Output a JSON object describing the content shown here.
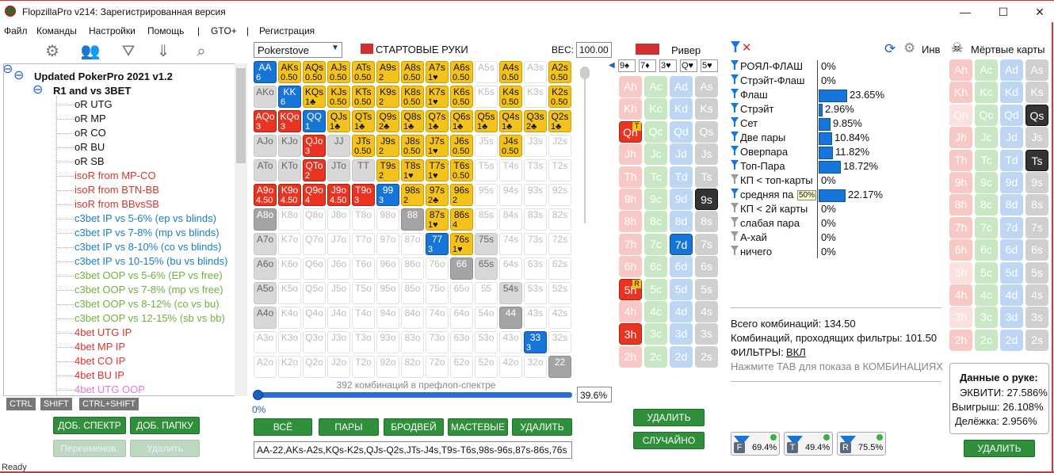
{
  "window": {
    "title": "FlopzillaPro v214: Зарегистрированная версия",
    "min": "—",
    "max": "☐",
    "close": "✕"
  },
  "menu": [
    "Файл",
    "Команды",
    "Настройки",
    "Помощь",
    "|",
    "GTO+",
    "|",
    "Регистрация"
  ],
  "toolbar_icons": [
    "gear-icon",
    "users-icon",
    "filter-icon",
    "download-icon",
    "search-icon"
  ],
  "tree": {
    "root_toggle": "⊖",
    "root": "Updated PokerPro 2021 v1.2",
    "folder_toggle": "⊖",
    "folder": "R1 and vs 3BET",
    "items": [
      {
        "label": "oR UTG",
        "color": "#111111"
      },
      {
        "label": "oR MP",
        "color": "#111111"
      },
      {
        "label": "oR CO",
        "color": "#111111"
      },
      {
        "label": "oR BU",
        "color": "#111111"
      },
      {
        "label": "oR SB",
        "color": "#111111"
      },
      {
        "label": "isoR from MP-CO",
        "color": "#d9342b"
      },
      {
        "label": "isoR from BTN-BB",
        "color": "#d9342b"
      },
      {
        "label": "isoR from BBvsSB",
        "color": "#d9342b"
      },
      {
        "label": "c3bet IP vs 5-6% (ep vs blinds)",
        "color": "#1a7fc4"
      },
      {
        "label": "c3bet IP vs 7-8% (mp vs blinds)",
        "color": "#1a7fc4"
      },
      {
        "label": "c3bet IP vs 8-10% (co vs blinds)",
        "color": "#1a7fc4"
      },
      {
        "label": "c3bet IP vs 10-15% (bu vs blinds)",
        "color": "#1a7fc4"
      },
      {
        "label": "c3bet OOP vs 5-6% (EP vs free)",
        "color": "#6cb33f"
      },
      {
        "label": "c3bet OOP vs 7-8% (mp vs free)",
        "color": "#6cb33f"
      },
      {
        "label": "c3bet OOP vs 8-12% (co vs bu)",
        "color": "#6cb33f"
      },
      {
        "label": "c3bet OOP vs 12-15% (sb vs bb)",
        "color": "#6cb33f"
      },
      {
        "label": "4bet UTG IP",
        "color": "#d9342b"
      },
      {
        "label": "4bet MP IP",
        "color": "#d9342b"
      },
      {
        "label": "4bet CO IP",
        "color": "#d9342b"
      },
      {
        "label": "4bet BU IP",
        "color": "#d9342b"
      },
      {
        "label": "4bet UTG OOP",
        "color": "#e077e0"
      }
    ]
  },
  "modkeys": [
    "CTRL",
    "SHIFT",
    "CTRL+SHIFT"
  ],
  "left_buttons": {
    "add_spectrum": "ДОБ. СПЕКТР",
    "add_folder": "ДОБ. ПАПКУ",
    "rename": "Переименов.",
    "delete": "Удалить"
  },
  "range": {
    "selector": "Pokerstove",
    "start_hands": "СТАРТОВЫЕ РУКИ",
    "weight_label": "ВЕС:",
    "weight_value": "100.00",
    "combo_count": "392 комбинаций в префлоп-спектре",
    "slider_min": "0%",
    "pct": "39.6%",
    "buttons": [
      "ВСЁ",
      "ПАРЫ",
      "БРОДВЕЙ",
      "МАСТЕВЫЕ",
      "УДАЛИТЬ"
    ],
    "text": "AA-22,AKs-A2s,KQs-K2s,QJs-Q2s,JTs-J4s,T9s-T6s,98s-96s,87s-86s,76s"
  },
  "grid": [
    [
      "b:AA:6",
      "y:AKs:0.50",
      "y:AQs:0.50",
      "y:AJs:0.50",
      "y:ATs:0.50",
      "y:A9s:2",
      "y:A8s:0.50",
      "y:A7s:1♥",
      "y:A6s:0.50",
      "e:A5s:",
      "y:A4s:0.50",
      "e:A3s:",
      "y:A2s:0.50"
    ],
    [
      "lg:AKo:",
      "b:KK:6",
      "y:KQs:1♣",
      "y:KJs:0.50",
      "y:KTs:0.50",
      "y:K9s:2",
      "y:K8s:0.50",
      "y:K7s:1♥",
      "y:K6s:0.50",
      "e:K5s:",
      "y:K4s:0.50",
      "e:K3s:",
      "y:K2s:0.50"
    ],
    [
      "r:AQo:3",
      "r:KQo:3",
      "b:QQ:1",
      "y:QJs:1♣",
      "y:QTs:1♣",
      "y:Q9s:2♣",
      "y:Q8s:1♣",
      "y:Q7s:1♣",
      "y:Q6s:1♣",
      "y:Q5s:1♣",
      "y:Q4s:1♣",
      "y:Q3s:2♣",
      "y:Q2s:1♣"
    ],
    [
      "lg:AJo:",
      "lg:KJo:",
      "r:QJo:3",
      "lg:JJ:",
      "y:JTs:0.50",
      "y:J9s:2",
      "y:J8s:0.50",
      "y:J7s:1♥",
      "y:J6s:0.50",
      "e:J5s:",
      "y:J4s:0.50",
      "e:J3s:",
      "e:J2s:"
    ],
    [
      "lg:ATo:",
      "lg:KTo:",
      "r:QTo:2",
      "lg:JTo:",
      "lg:TT:",
      "y:T9s:2",
      "y:T8s:1♥",
      "y:T7s:1♥",
      "y:T6s:0.50",
      "e:T5s:",
      "e:T4s:",
      "e:T3s:",
      "e:T2s:"
    ],
    [
      "r:A9o:4.50",
      "r:K9o:4.50",
      "r:Q9o:4",
      "r:J9o:4.50",
      "r:T9o:3",
      "b:99:3",
      "y:98s:2",
      "y:97s:2♣",
      "y:96s:2",
      "e:95s:",
      "e:94s:",
      "e:93s:",
      "e:92s:"
    ],
    [
      "g:A8o:",
      "e:K8o:",
      "e:Q8o:",
      "e:J8o:",
      "e:T8o:",
      "e:98o:",
      "g:88:",
      "y:87s:1♥",
      "y:86s:4",
      "e:85s:",
      "e:84s:",
      "e:83s:",
      "e:82s:"
    ],
    [
      "lg:A7o:",
      "e:K7o:",
      "e:Q7o:",
      "e:J7o:",
      "e:T7o:",
      "e:97o:",
      "e:87o:",
      "b:77:3",
      "y:76s:1♥",
      "lg:75s:",
      "e:74s:",
      "e:73s:",
      "e:72s:"
    ],
    [
      "lg:A6o:",
      "e:K6o:",
      "e:Q6o:",
      "e:J6o:",
      "e:T6o:",
      "e:96o:",
      "e:86o:",
      "e:76o:",
      "g:66:",
      "lg:65s:",
      "e:64s:",
      "e:63s:",
      "e:62s:"
    ],
    [
      "lg:A5o:",
      "e:K5o:",
      "e:Q5o:",
      "e:J5o:",
      "e:T5o:",
      "e:95o:",
      "e:85o:",
      "e:75o:",
      "e:65o:",
      "e:55:",
      "lg:54s:",
      "e:53s:",
      "e:52s:"
    ],
    [
      "lg:A4o:",
      "e:K4o:",
      "e:Q4o:",
      "e:J4o:",
      "e:T4o:",
      "e:94o:",
      "e:84o:",
      "e:74o:",
      "e:64o:",
      "e:54o:",
      "g:44:",
      "e:43s:",
      "e:42s:"
    ],
    [
      "e:A3o:",
      "e:K3o:",
      "e:Q3o:",
      "e:J3o:",
      "e:T3o:",
      "e:93o:",
      "e:83o:",
      "e:73o:",
      "e:63o:",
      "e:53o:",
      "e:43o:",
      "b:33:3",
      "e:32s:"
    ],
    [
      "e:A2o:",
      "e:K2o:",
      "e:Q2o:",
      "e:J2o:",
      "e:T2o:",
      "e:92o:",
      "e:82o:",
      "e:72o:",
      "e:62o:",
      "e:52o:",
      "e:42o:",
      "e:32o:",
      "g:22:"
    ]
  ],
  "river": {
    "label": "Ривер",
    "board": [
      "9♠",
      "7♦",
      "3♥",
      "Q♥",
      "5♥"
    ],
    "delete": "УДАЛИТЬ",
    "random": "СЛУЧАЙНО"
  },
  "deck": [
    [
      "h:Ah",
      "c:Ac",
      "d:Ad",
      "s:As"
    ],
    [
      "h:Kh",
      "c:Kc",
      "d:Kd",
      "s:Ks"
    ],
    [
      "hs:Qh:T",
      "c:Qc",
      "d:Qd",
      "s:Qs"
    ],
    [
      "h:Jh",
      "c:Jc",
      "d:Jd",
      "s:Js"
    ],
    [
      "h:Th",
      "c:Tc",
      "d:Td",
      "s:Ts"
    ],
    [
      "h:9h",
      "c:9c",
      "d:9d",
      "ss:9s"
    ],
    [
      "h:8h",
      "c:8c",
      "d:8d",
      "s:8s"
    ],
    [
      "h:7h",
      "c:7c",
      "ds:7d",
      "s:7s"
    ],
    [
      "h:6h",
      "c:6c",
      "d:6d",
      "s:6s"
    ],
    [
      "hs:5h:R",
      "c:5c",
      "d:5d",
      "s:5s"
    ],
    [
      "h:4h",
      "c:4c",
      "d:4d",
      "s:4s"
    ],
    [
      "hs:3h",
      "c:3c",
      "d:3d",
      "s:3s"
    ],
    [
      "h:2h",
      "c:2c",
      "d:2d",
      "s:2s"
    ]
  ],
  "stats": {
    "inv_label": "Инв",
    "rows": [
      {
        "label": "РОЯЛ-ФЛАШ",
        "value": "0%",
        "pct": 0,
        "on": true
      },
      {
        "label": "Стрэйт-Флаш",
        "value": "0%",
        "pct": 0,
        "on": true
      },
      {
        "label": "Флаш",
        "value": "23.65%",
        "pct": 23.65,
        "on": true
      },
      {
        "label": "Стрэйт",
        "value": "2.96%",
        "pct": 2.96,
        "on": true
      },
      {
        "label": "Сет",
        "value": "9.85%",
        "pct": 9.85,
        "on": true
      },
      {
        "label": "Две пары",
        "value": "10.84%",
        "pct": 10.84,
        "on": true
      },
      {
        "label": "Оверпара",
        "value": "11.82%",
        "pct": 11.82,
        "on": true
      },
      {
        "label": "Топ-Пара",
        "value": "18.72%",
        "pct": 18.72,
        "on": true
      },
      {
        "label": "КП < топ-карты",
        "value": "0%",
        "pct": 0,
        "on": false
      },
      {
        "label": "средняя па",
        "value": "22.17%",
        "pct": 22.17,
        "on": true,
        "tag": "50%"
      },
      {
        "label": "КП < 2й карты",
        "value": "0%",
        "pct": 0,
        "on": false
      },
      {
        "label": "слабая пара",
        "value": "0%",
        "pct": 0,
        "on": false
      },
      {
        "label": "А-хай",
        "value": "0%",
        "pct": 0,
        "on": false
      },
      {
        "label": "ничего",
        "value": "0%",
        "pct": 0,
        "on": false
      }
    ],
    "total": "Всего комбинаций: 134.50",
    "passing": "Комбинаций, проходящих фильтры: 101.50",
    "filters_label": "ФИЛЬТРЫ:",
    "filters_value": "ВКЛ",
    "tab_hint": "Нажмите TAB для показа в КОМБИНАЦИЯХ"
  },
  "hand_data": {
    "title": "Данные о руке:",
    "equity": "ЭКВИТИ: 27.586%",
    "win": "Выигрыш: 26.108%",
    "tie": "Делёжка: 2.956%"
  },
  "filters": [
    {
      "letter": "F",
      "pct": "69.4%"
    },
    {
      "letter": "T",
      "pct": "49.4%"
    },
    {
      "letter": "R",
      "pct": "75.5%"
    }
  ],
  "dead": {
    "label": "Мёртвые карты",
    "delete": "УДАЛИТЬ"
  },
  "dead_deck": [
    [
      "h:Ah",
      "c:Ac",
      "d:Ad",
      "s:As"
    ],
    [
      "h:Kh",
      "c:Kc",
      "d:Kd",
      "s:Ks"
    ],
    [
      "hl:Qh",
      "c:Qc",
      "d:Qd",
      "ss:Qs"
    ],
    [
      "h:Jh",
      "c:Jc",
      "d:Jd",
      "s:Js"
    ],
    [
      "h:Th",
      "c:Tc",
      "d:Td",
      "ss:Ts"
    ],
    [
      "h:9h",
      "c:9c",
      "d:9d",
      "s:9s"
    ],
    [
      "h:8h",
      "c:8c",
      "d:8d",
      "s:8s"
    ],
    [
      "h:7h",
      "c:7c",
      "d:7d",
      "s:7s"
    ],
    [
      "h:6h",
      "c:6c",
      "d:6d",
      "s:6s"
    ],
    [
      "hl:5h",
      "c:5c",
      "d:5d",
      "s:5s"
    ],
    [
      "h:4h",
      "c:4c",
      "d:4d",
      "s:4s"
    ],
    [
      "hl:3h",
      "c:3c",
      "d:3d",
      "s:3s"
    ],
    [
      "h:2h",
      "c:2c",
      "d:2d",
      "s:2s"
    ]
  ],
  "status": "Ready"
}
